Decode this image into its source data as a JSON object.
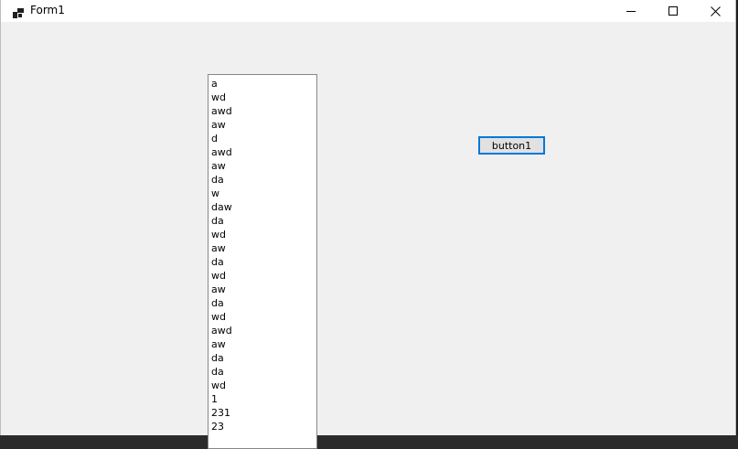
{
  "window": {
    "title": "Form1",
    "icon": "winforms-app-icon",
    "controls": {
      "minimize": "minimize-icon",
      "maximize": "maximize-icon",
      "close": "close-icon"
    }
  },
  "listbox": {
    "items": [
      "a",
      "wd",
      "awd",
      "aw",
      "d",
      "awd",
      "aw",
      "da",
      "w",
      "daw",
      "da",
      "wd",
      "aw",
      "da",
      "wd",
      "aw",
      "da",
      "wd",
      "awd",
      "aw",
      "da",
      "da",
      "wd",
      "1",
      "231",
      "23"
    ]
  },
  "button1": {
    "label": "button1"
  },
  "colors": {
    "form_background": "#f0f0f0",
    "titlebar_background": "#ffffff",
    "focus_border": "#0078d7",
    "listbox_border": "#828790"
  }
}
